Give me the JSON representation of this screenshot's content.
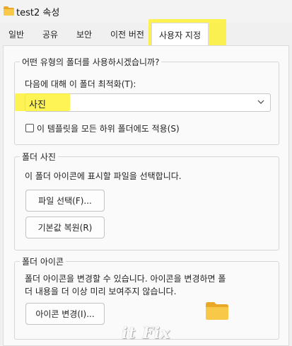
{
  "window": {
    "title": "test2 속성"
  },
  "tabs": [
    {
      "label": "일반"
    },
    {
      "label": "공유"
    },
    {
      "label": "보안"
    },
    {
      "label": "이전 버전"
    },
    {
      "label": "사용자 지정"
    }
  ],
  "optimize_group": {
    "title": "어떤 유형의 폴더를 사용하시겠습니까?",
    "optimize_label": "다음에 대해 이 폴더 최적화(T):",
    "selected_type": "사진",
    "apply_subfolders_label": "이 템플릿을 모든 하위 폴더에도 적용(S)",
    "apply_subfolders_checked": false
  },
  "folder_picture_group": {
    "title": "폴더 사진",
    "description": "이 폴더 아이콘에 표시할 파일을 선택합니다.",
    "choose_file_button": "파일 선택(F)...",
    "restore_default_button": "기본값 복원(R)"
  },
  "folder_icon_group": {
    "title": "폴더 아이콘",
    "description_line1": "폴더 아이콘을 변경할 수 있습니다. 아이콘을 변경하면 폴",
    "description_line2": "더 내용을 더 이상  미리 보여주지 않습니다.",
    "change_icon_button": "아이콘 변경(I)..."
  },
  "watermark": "it Fix",
  "colors": {
    "highlight": "#fff014",
    "folder_yellow": "#f8c948"
  },
  "icons": [
    "folder-icon",
    "chevron-down-icon"
  ]
}
